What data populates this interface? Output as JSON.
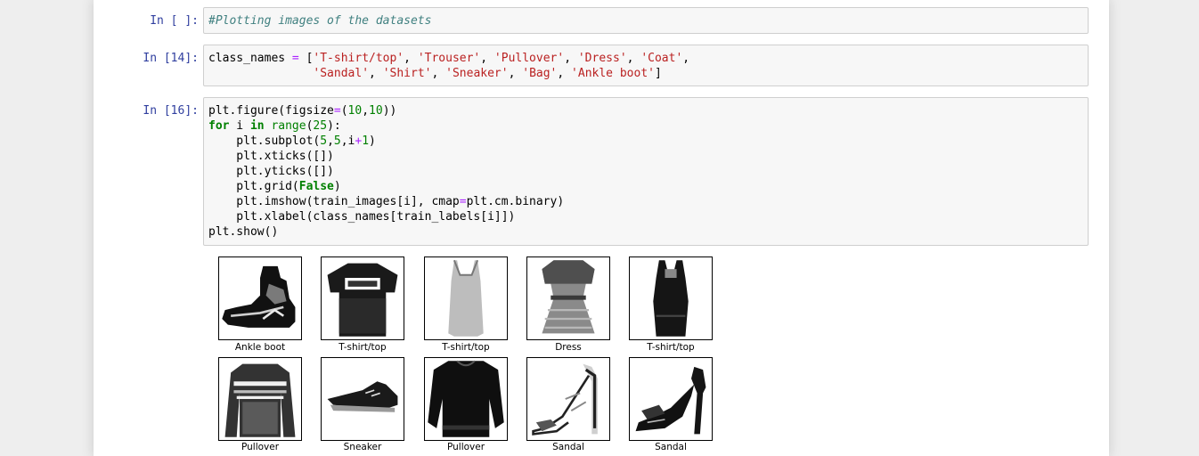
{
  "cells": {
    "c1": {
      "prompt": "In [ ]:",
      "lines": [
        [
          {
            "t": "#Plotting images of the datasets",
            "c": "cm-comment"
          }
        ]
      ]
    },
    "c2": {
      "prompt": "In [14]:",
      "lines": [
        [
          {
            "t": "class_names "
          },
          {
            "t": "=",
            "c": "cm-operator"
          },
          {
            "t": " ["
          },
          {
            "t": "'T-shirt/top'",
            "c": "cm-string"
          },
          {
            "t": ", "
          },
          {
            "t": "'Trouser'",
            "c": "cm-string"
          },
          {
            "t": ", "
          },
          {
            "t": "'Pullover'",
            "c": "cm-string"
          },
          {
            "t": ", "
          },
          {
            "t": "'Dress'",
            "c": "cm-string"
          },
          {
            "t": ", "
          },
          {
            "t": "'Coat'",
            "c": "cm-string"
          },
          {
            "t": ","
          }
        ],
        [
          {
            "t": "               "
          },
          {
            "t": "'Sandal'",
            "c": "cm-string"
          },
          {
            "t": ", "
          },
          {
            "t": "'Shirt'",
            "c": "cm-string"
          },
          {
            "t": ", "
          },
          {
            "t": "'Sneaker'",
            "c": "cm-string"
          },
          {
            "t": ", "
          },
          {
            "t": "'Bag'",
            "c": "cm-string"
          },
          {
            "t": ", "
          },
          {
            "t": "'Ankle boot'",
            "c": "cm-string"
          },
          {
            "t": "]"
          }
        ]
      ]
    },
    "c3": {
      "prompt": "In [16]:",
      "lines": [
        [
          {
            "t": "plt.figure(figsize"
          },
          {
            "t": "=",
            "c": "cm-operator"
          },
          {
            "t": "("
          },
          {
            "t": "10",
            "c": "cm-number"
          },
          {
            "t": ","
          },
          {
            "t": "10",
            "c": "cm-number"
          },
          {
            "t": "))"
          }
        ],
        [
          {
            "t": "for",
            "c": "cm-keyword"
          },
          {
            "t": " i "
          },
          {
            "t": "in",
            "c": "cm-keyword"
          },
          {
            "t": " "
          },
          {
            "t": "range",
            "c": "cm-builtin"
          },
          {
            "t": "("
          },
          {
            "t": "25",
            "c": "cm-number"
          },
          {
            "t": "):"
          }
        ],
        [
          {
            "t": "    plt.subplot("
          },
          {
            "t": "5",
            "c": "cm-number"
          },
          {
            "t": ","
          },
          {
            "t": "5",
            "c": "cm-number"
          },
          {
            "t": ",i"
          },
          {
            "t": "+",
            "c": "cm-operator"
          },
          {
            "t": "1",
            "c": "cm-number"
          },
          {
            "t": ")"
          }
        ],
        [
          {
            "t": "    plt.xticks([])"
          }
        ],
        [
          {
            "t": "    plt.yticks([])"
          }
        ],
        [
          {
            "t": "    plt.grid("
          },
          {
            "t": "False",
            "c": "cm-keyword"
          },
          {
            "t": ")"
          }
        ],
        [
          {
            "t": "    plt.imshow(train_images[i], cmap"
          },
          {
            "t": "=",
            "c": "cm-operator"
          },
          {
            "t": "plt.cm.binary)"
          }
        ],
        [
          {
            "t": "    plt.xlabel(class_names[train_labels[i]])"
          }
        ],
        [
          {
            "t": "plt.show()"
          }
        ]
      ]
    }
  },
  "output": {
    "thumbnails": [
      {
        "label": "Ankle boot",
        "icon": "ankle-boot-image"
      },
      {
        "label": "T-shirt/top",
        "icon": "tshirt-image"
      },
      {
        "label": "T-shirt/top",
        "icon": "tank-top-image"
      },
      {
        "label": "Dress",
        "icon": "dress-image"
      },
      {
        "label": "T-shirt/top",
        "icon": "sleeveless-top-image"
      },
      {
        "label": "Pullover",
        "icon": "striped-pullover-image"
      },
      {
        "label": "Sneaker",
        "icon": "sneaker-image"
      },
      {
        "label": "Pullover",
        "icon": "dark-pullover-image"
      },
      {
        "label": "Sandal",
        "icon": "sandal-image"
      },
      {
        "label": "Sandal",
        "icon": "heeled-sandal-image"
      }
    ]
  }
}
